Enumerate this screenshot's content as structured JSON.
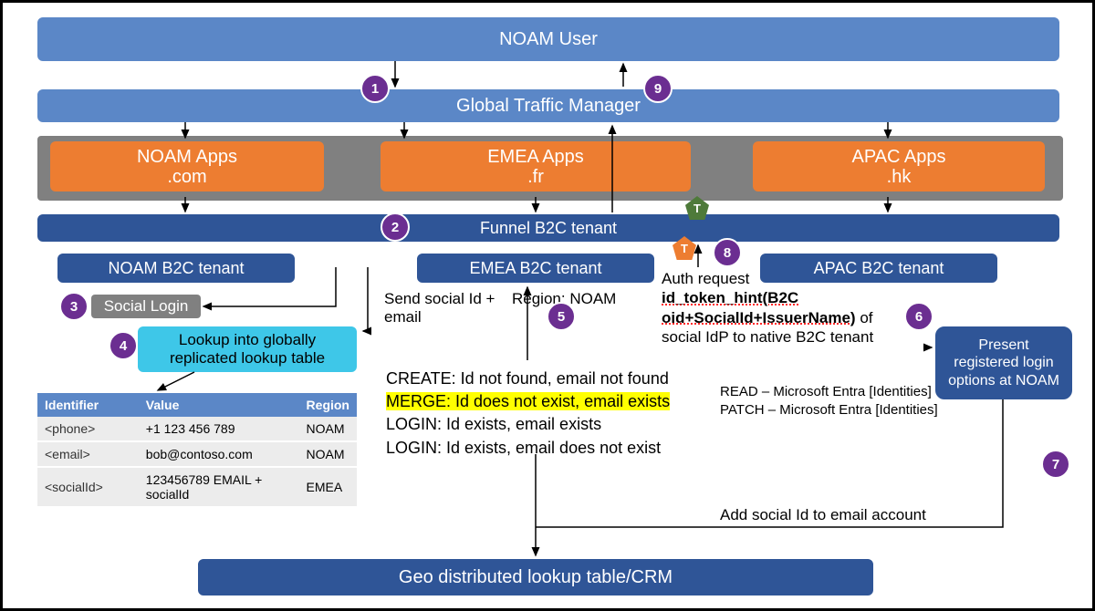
{
  "boxes": {
    "noam_user": "NOAM User",
    "gtm": "Global Traffic Manager",
    "noam_apps_l1": "NOAM Apps",
    "noam_apps_l2": ".com",
    "emea_apps_l1": "EMEA Apps",
    "emea_apps_l2": ".fr",
    "apac_apps_l1": "APAC Apps",
    "apac_apps_l2": ".hk",
    "funnel": "Funnel B2C tenant",
    "noam_tenant": "NOAM B2C tenant",
    "emea_tenant": "EMEA B2C tenant",
    "apac_tenant": "APAC B2C tenant",
    "social_login": "Social Login",
    "lookup_l1": "Lookup into globally",
    "lookup_l2": "replicated lookup table",
    "present_l1": "Present",
    "present_l2": "registered login",
    "present_l3": "options at NOAM",
    "geo": "Geo distributed lookup table/CRM"
  },
  "badges": {
    "b1": "1",
    "b2": "2",
    "b3": "3",
    "b4": "4",
    "b5": "5",
    "b6": "6",
    "b7": "7",
    "b8": "8",
    "b9": "9"
  },
  "pent": {
    "t1": "T",
    "t2": "T"
  },
  "labels": {
    "send_l1": "Send social Id +",
    "send_l2": "email",
    "region": "Region: NOAM",
    "auth_l1": "Auth request",
    "auth_l2_a": "id_token_hint(B2C",
    "auth_l2_b": "oid+SocialId+IssuerName)",
    "auth_l2_c": " of",
    "auth_l3": "social IdP to native B2C tenant",
    "read": "READ – Microsoft Entra [Identities]",
    "patch": "PATCH – Microsoft Entra [Identities]",
    "add_social": "Add social Id to email account"
  },
  "rules": {
    "create": "CREATE: Id not found, email not found",
    "merge": "MERGE: Id does not exist, email exists",
    "login1": "LOGIN: Id exists, email exists",
    "login2": "LOGIN: Id exists, email does not exist"
  },
  "table": {
    "h1": "Identifier",
    "h2": "Value",
    "h3": "Region",
    "r1c1": "<phone>",
    "r1c2": "+1 123 456 789",
    "r1c3": "NOAM",
    "r2c1": "<email>",
    "r2c2": "bob@contoso.com",
    "r2c3": "NOAM",
    "r3c1": "<socialId>",
    "r3c2": "123456789 EMAIL + socialId",
    "r3c3": "EMEA"
  }
}
